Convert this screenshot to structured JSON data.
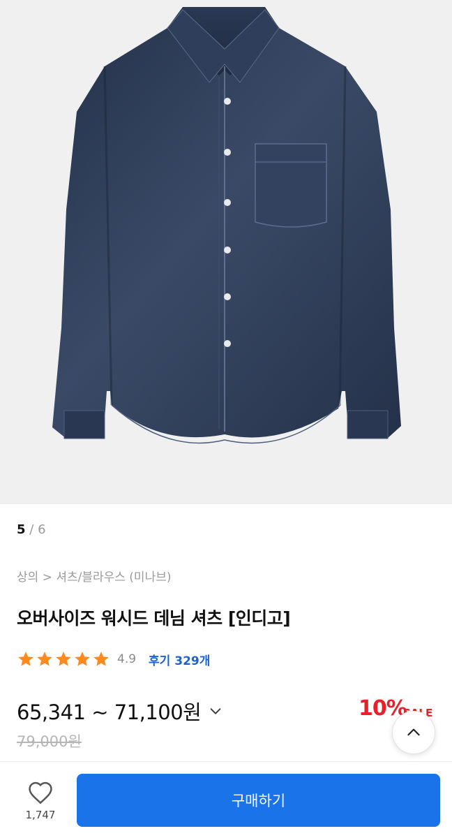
{
  "gallery": {
    "current": "5",
    "separator": "/",
    "total": "6"
  },
  "breadcrumb": "상의 > 셔츠/블라우스 (미나브)",
  "product": {
    "title": "오버사이즈 워시드 데님 셔츠 [인디고]",
    "rating": {
      "stars": 5,
      "score": "4.9",
      "reviews": "후기 329개"
    },
    "price_range": "65,341 ~ 71,100원",
    "discount": "10%",
    "sale_badge": "SALE",
    "original_price": "79,000원"
  },
  "actions": {
    "like_count": "1,747",
    "buy_label": "구매하기"
  },
  "colors": {
    "primary": "#1a73e8",
    "sale": "#e8202a",
    "star": "#ff8a1f",
    "denim": "#2b3a55"
  },
  "icons": [
    "heart-icon",
    "chevron-down-icon",
    "chevron-up-icon",
    "star-icon"
  ]
}
